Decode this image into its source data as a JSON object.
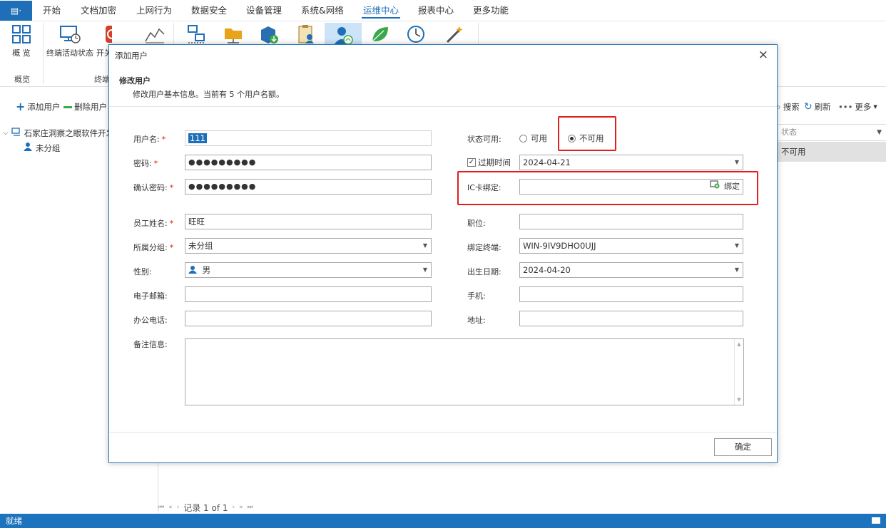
{
  "menubar": {
    "app_button": "▤",
    "items": [
      "开始",
      "文档加密",
      "上网行为",
      "数据安全",
      "设备管理",
      "系统&网络",
      "运维中心",
      "报表中心",
      "更多功能"
    ],
    "active_index": 6
  },
  "ribbon": {
    "items": [
      {
        "label": "概 览"
      },
      {
        "label": "终端活动状态"
      },
      {
        "label": "开关"
      }
    ],
    "groups": [
      "概览",
      "终端"
    ]
  },
  "toolbar": {
    "add_user": "添加用户",
    "delete_user": "删除用户",
    "search": "搜索",
    "refresh": "刷新",
    "more": "更多"
  },
  "tree": {
    "root": "石家庄洞察之眼软件开发有",
    "child": "未分组"
  },
  "grid": {
    "status_header": "状态",
    "status_value": "不可用"
  },
  "pager": {
    "text": "记录 1 of 1"
  },
  "statusbar": {
    "text": "就绪"
  },
  "dialog": {
    "title": "添加用户",
    "heading": "修改用户",
    "subtitle": "修改用户基本信息。当前有 5 个用户名额。",
    "fields": {
      "username": {
        "label": "用户名:",
        "value": "111"
      },
      "password": {
        "label": "密码:",
        "value": "●●●●●●●●●"
      },
      "confirm_password": {
        "label": "确认密码:",
        "value": "●●●●●●●●●"
      },
      "employee_name": {
        "label": "员工姓名:",
        "value": "旺旺"
      },
      "group": {
        "label": "所属分组:",
        "value": "未分组"
      },
      "gender": {
        "label": "性别:",
        "value": "男"
      },
      "email": {
        "label": "电子邮箱:",
        "value": ""
      },
      "office_phone": {
        "label": "办公电话:",
        "value": ""
      },
      "remarks": {
        "label": "备注信息:",
        "value": ""
      },
      "status": {
        "label": "状态可用:",
        "options": [
          "可用",
          "不可用"
        ],
        "selected": "不可用"
      },
      "expire": {
        "label": "过期时间",
        "checked": true,
        "value": "2024-04-21"
      },
      "ic_card": {
        "label": "IC卡绑定:",
        "value": "",
        "bind_label": "绑定"
      },
      "position": {
        "label": "职位:",
        "value": ""
      },
      "bound_terminal": {
        "label": "绑定终端:",
        "value": "WIN-9IV9DHO0UJJ"
      },
      "birth_date": {
        "label": "出生日期:",
        "value": "2024-04-20"
      },
      "mobile": {
        "label": "手机:",
        "value": ""
      },
      "address": {
        "label": "地址:",
        "value": ""
      }
    },
    "required_mark": "*",
    "ok_label": "确定",
    "close_icon": "×"
  },
  "colors": {
    "accent": "#1e6fb8",
    "statusbar": "#1e73be",
    "highlight_box": "#e02020",
    "selected_row": "#e1e1e1"
  }
}
